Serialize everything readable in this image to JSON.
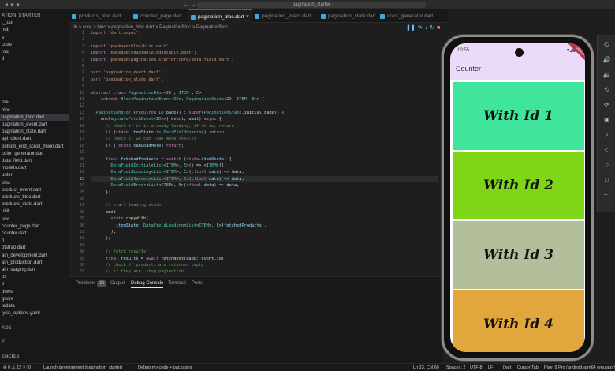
{
  "window": {
    "title": "pagination_starter"
  },
  "tabs": [
    {
      "label": "products_bloc.dart",
      "active": false
    },
    {
      "label": "counter_page.dart",
      "active": false
    },
    {
      "label": "pagination_bloc.dart",
      "active": true
    },
    {
      "label": "pagination_event.dart",
      "active": false
    },
    {
      "label": "pagination_state.dart",
      "active": false
    },
    {
      "label": "color_generator.dart",
      "active": false
    }
  ],
  "breadcrumb": "lib > core > bloc > pagination_bloc.dart > PaginationBloc > PaginationBloc",
  "sidebar": {
    "items": [
      {
        "label": "ATION_STARTER",
        "kind": "section"
      },
      {
        "label": "t_tool"
      },
      {
        "label": "hub"
      },
      {
        "label": "e"
      },
      {
        "label": "code"
      },
      {
        "label": "roid"
      },
      {
        "label": "d"
      },
      {
        "label": ""
      },
      {
        "label": ""
      },
      {
        "label": ""
      },
      {
        "label": ""
      },
      {
        "label": ""
      },
      {
        "label": "ore"
      },
      {
        "label": "bloc"
      },
      {
        "label": "pagination_bloc.dart",
        "active": true
      },
      {
        "label": "pagination_event.dart"
      },
      {
        "label": "pagination_state.dart"
      },
      {
        "label": "api_client.dart"
      },
      {
        "label": "bottom_end_scroll_mixin.dart"
      },
      {
        "label": "color_generator.dart"
      },
      {
        "label": "data_field.dart"
      },
      {
        "label": "models.dart"
      },
      {
        "label": "unter"
      },
      {
        "label": "bloc"
      },
      {
        "label": "product_event.dart"
      },
      {
        "label": "products_bloc.dart"
      },
      {
        "label": "products_state.dart"
      },
      {
        "label": "ubit"
      },
      {
        "label": "iew"
      },
      {
        "label": "counter_page.dart"
      },
      {
        "label": "counter.dart"
      },
      {
        "label": "n"
      },
      {
        "label": "otstrap.dart"
      },
      {
        "label": "ain_development.dart"
      },
      {
        "label": "ain_production.dart"
      },
      {
        "label": "ain_staging.dart"
      },
      {
        "label": "os"
      },
      {
        "label": "b"
      },
      {
        "label": "dows"
      },
      {
        "label": "gnore"
      },
      {
        "label": "tadata"
      },
      {
        "label": "lysis_options.yaml"
      },
      {
        "label": ""
      },
      {
        "label": "ADS",
        "kind": "section"
      },
      {
        "label": ""
      },
      {
        "label": "E",
        "kind": "section"
      },
      {
        "label": ""
      },
      {
        "label": "ENCIES",
        "kind": "section"
      }
    ]
  },
  "code": {
    "current_line": 23,
    "first_line": 1,
    "lines": [
      [
        [
          "kw",
          "import "
        ],
        [
          "st",
          "'dart:async'"
        ],
        [
          "",
          "; "
        ]
      ],
      [],
      [
        [
          "kw",
          "import "
        ],
        [
          "st",
          "'package:bloc/bloc.dart'"
        ],
        [
          "",
          ";"
        ]
      ],
      [
        [
          "kw",
          "import "
        ],
        [
          "st",
          "'package:equatable/equatable.dart'"
        ],
        [
          "",
          ";"
        ]
      ],
      [
        [
          "kw",
          "import "
        ],
        [
          "st",
          "'package:pagination_starter/core/data_field.dart'"
        ],
        [
          "",
          ";"
        ]
      ],
      [],
      [
        [
          "kw",
          "part "
        ],
        [
          "st",
          "'pagination_event.dart'"
        ],
        [
          "",
          ";"
        ]
      ],
      [
        [
          "kw",
          "part "
        ],
        [
          "st",
          "'pagination_state.dart'"
        ],
        [
          "",
          ";"
        ]
      ],
      [],
      [
        [
          "kw",
          "abstract class "
        ],
        [
          "ty",
          "PaginationBloc"
        ],
        [
          "",
          "<"
        ],
        [
          "ty",
          "ID"
        ],
        [
          "",
          " , "
        ],
        [
          "ty",
          "ITEM"
        ],
        [
          "",
          " , "
        ],
        [
          "ty",
          "E"
        ],
        [
          "",
          ">"
        ]
      ],
      [
        [
          "",
          "    "
        ],
        [
          "kw",
          "extends "
        ],
        [
          "ty",
          "Bloc"
        ],
        [
          "",
          "<"
        ],
        [
          "ty",
          "PaginationEvent"
        ],
        [
          "",
          "<"
        ],
        [
          "ty",
          "ID"
        ],
        [
          "",
          ">, "
        ],
        [
          "ty",
          "PaginationState"
        ],
        [
          "",
          "<"
        ],
        [
          "ty",
          "ID"
        ],
        [
          "",
          ", "
        ],
        [
          "ty",
          "ITEM"
        ],
        [
          "",
          ", "
        ],
        [
          "ty",
          "E"
        ],
        [
          "",
          ">> {"
        ]
      ],
      [],
      [
        [
          "",
          "  "
        ],
        [
          "ty",
          "PaginationBloc"
        ],
        [
          "",
          "({"
        ],
        [
          "kw",
          "required "
        ],
        [
          "ty",
          "ID "
        ],
        [
          "va",
          "page"
        ],
        [
          "",
          "}) : "
        ],
        [
          "kw",
          "super"
        ],
        [
          "",
          "("
        ],
        [
          "ty",
          "PaginationState"
        ],
        [
          "",
          "."
        ],
        [
          "fn",
          "initial"
        ],
        [
          "",
          "("
        ],
        [
          "va",
          "page"
        ],
        [
          "",
          ")) {"
        ]
      ],
      [
        [
          "",
          "    "
        ],
        [
          "fn",
          "on"
        ],
        [
          "",
          "<"
        ],
        [
          "ty",
          "PaginateFetchEvent"
        ],
        [
          "",
          "<"
        ],
        [
          "ty",
          "ID"
        ],
        [
          "",
          ">>((event, emit) "
        ],
        [
          "kw",
          "async "
        ],
        [
          "",
          "{"
        ]
      ],
      [
        [
          "",
          "      "
        ],
        [
          "cm",
          "// check if it is already loading, if it is, return"
        ]
      ],
      [
        [
          "",
          "      "
        ],
        [
          "kw",
          "if "
        ],
        [
          "",
          "("
        ],
        [
          "kw",
          "state"
        ],
        [
          "",
          "."
        ],
        [
          "va",
          "itemState "
        ],
        [
          "kw",
          "is "
        ],
        [
          "ty",
          "DataFieldLoading"
        ],
        [
          "",
          ") "
        ],
        [
          "kw",
          "return"
        ],
        [
          "",
          ";"
        ]
      ],
      [
        [
          "",
          "      "
        ],
        [
          "cm",
          "// check if we can load more results"
        ]
      ],
      [
        [
          "",
          "      "
        ],
        [
          "kw",
          "if "
        ],
        [
          "",
          "(!"
        ],
        [
          "kw",
          "state"
        ],
        [
          "",
          "."
        ],
        [
          "va",
          "canLoadMore"
        ],
        [
          "",
          ") "
        ],
        [
          "kw",
          "return"
        ],
        [
          "",
          ";"
        ]
      ],
      [],
      [
        [
          "",
          "      "
        ],
        [
          "kw",
          "final "
        ],
        [
          "va",
          "fetchedProducts "
        ],
        [
          "",
          "= "
        ],
        [
          "kw",
          "switch "
        ],
        [
          "",
          "("
        ],
        [
          "kw",
          "state"
        ],
        [
          "",
          "."
        ],
        [
          "va",
          "itemState"
        ],
        [
          "",
          ") {"
        ]
      ],
      [
        [
          "",
          "        "
        ],
        [
          "ty",
          "DataFieldInitial"
        ],
        [
          "",
          "<"
        ],
        [
          "ty",
          "List"
        ],
        [
          "",
          "<"
        ],
        [
          "ty",
          "ITEM"
        ],
        [
          "",
          ">, "
        ],
        [
          "ty",
          "E"
        ],
        [
          "",
          ">() => <"
        ],
        [
          "ty",
          "ITEM"
        ],
        [
          "",
          ">[],"
        ]
      ],
      [
        [
          "",
          "        "
        ],
        [
          "ty",
          "DataFieldLoading"
        ],
        [
          "",
          "<"
        ],
        [
          "ty",
          "List"
        ],
        [
          "",
          "<"
        ],
        [
          "ty",
          "ITEM"
        ],
        [
          "",
          ">, "
        ],
        [
          "ty",
          "E"
        ],
        [
          "",
          ">(:"
        ],
        [
          "kw",
          "final "
        ],
        [
          "va",
          "data"
        ],
        [
          "",
          ") => "
        ],
        [
          "va",
          "data"
        ],
        [
          "",
          ","
        ]
      ],
      [
        [
          "",
          "        "
        ],
        [
          "ty",
          "DataFieldSuccess"
        ],
        [
          "",
          "<"
        ],
        [
          "ty",
          "List"
        ],
        [
          "",
          "<"
        ],
        [
          "ty",
          "ITEM"
        ],
        [
          "",
          ">, "
        ],
        [
          "ty",
          "E"
        ],
        [
          "",
          ">(:"
        ],
        [
          "kw",
          "final "
        ],
        [
          "va",
          "data"
        ],
        [
          "",
          ") => "
        ],
        [
          "va",
          "data"
        ],
        [
          "",
          ","
        ]
      ],
      [
        [
          "",
          "        "
        ],
        [
          "ty",
          "DataFieldError"
        ],
        [
          "",
          "<"
        ],
        [
          "ty",
          "List"
        ],
        [
          "",
          "<"
        ],
        [
          "ty",
          "ITEM"
        ],
        [
          "",
          ">, "
        ],
        [
          "ty",
          "E"
        ],
        [
          "",
          ">(:"
        ],
        [
          "kw",
          "final "
        ],
        [
          "va",
          "data"
        ],
        [
          "",
          ") => "
        ],
        [
          "va",
          "data"
        ],
        [
          "",
          ","
        ]
      ],
      [
        [
          "",
          "      };"
        ]
      ],
      [],
      [
        [
          "",
          "      "
        ],
        [
          "cm",
          "// start loading state"
        ]
      ],
      [
        [
          "",
          "      "
        ],
        [
          "fn",
          "emit"
        ],
        [
          "",
          "("
        ]
      ],
      [
        [
          "",
          "        "
        ],
        [
          "kw",
          "state"
        ],
        [
          "",
          "."
        ],
        [
          "fn",
          "copyWith"
        ],
        [
          "",
          "("
        ]
      ],
      [
        [
          "",
          "          "
        ],
        [
          "va",
          "itemState"
        ],
        [
          "",
          ": "
        ],
        [
          "ty",
          "DataFieldLoading"
        ],
        [
          "",
          "<"
        ],
        [
          "ty",
          "List"
        ],
        [
          "",
          "<"
        ],
        [
          "ty",
          "ITEM"
        ],
        [
          "",
          ">, "
        ],
        [
          "ty",
          "E"
        ],
        [
          "",
          ">("
        ],
        [
          "va",
          "fetchedProducts"
        ],
        [
          "",
          "),"
        ]
      ],
      [
        [
          "",
          "        ),"
        ]
      ],
      [
        [
          "",
          "      );"
        ]
      ],
      [],
      [
        [
          "",
          "      "
        ],
        [
          "cm",
          "// fetch results"
        ]
      ],
      [
        [
          "",
          "      "
        ],
        [
          "kw",
          "final "
        ],
        [
          "va",
          "results "
        ],
        [
          "",
          "= "
        ],
        [
          "kw",
          "await "
        ],
        [
          "fn",
          "fetchNext"
        ],
        [
          "",
          "("
        ],
        [
          "va",
          "page"
        ],
        [
          "",
          ": event."
        ],
        [
          "va",
          "id"
        ],
        [
          "",
          ");"
        ]
      ],
      [
        [
          "",
          "      "
        ],
        [
          "cm",
          "// check if products are returned empty"
        ]
      ],
      [
        [
          "",
          "      "
        ],
        [
          "cm",
          "// if they are, stop pagination"
        ]
      ],
      [
        [
          "",
          "      "
        ],
        [
          "kw",
          "if "
        ],
        [
          "",
          "("
        ],
        [
          "va",
          "results"
        ],
        [
          "",
          "."
        ],
        [
          "va",
          "$1"
        ],
        [
          "",
          "."
        ],
        [
          "va",
          "isEmpty"
        ],
        [
          "",
          ") {"
        ]
      ],
      [
        [
          "",
          "        "
        ],
        [
          "fn",
          "emit"
        ],
        [
          "",
          "("
        ]
      ],
      [
        [
          "",
          "          "
        ],
        [
          "kw",
          "state"
        ],
        [
          "",
          "."
        ],
        [
          "fn",
          "copyWith"
        ],
        [
          "",
          "("
        ]
      ]
    ]
  },
  "panel": {
    "tabs": [
      {
        "label": "Problems",
        "badge": "10"
      },
      {
        "label": "Output"
      },
      {
        "label": "Debug Console",
        "active": true
      },
      {
        "label": "Terminal"
      },
      {
        "label": "Ports"
      }
    ]
  },
  "statusbar": {
    "errors": "0",
    "warnings": "12",
    "info": "0",
    "launch": "Launch development (pagination_starter)",
    "debug": "Debug my code + packages",
    "position": "Ln 23, Col 60",
    "spaces": "Spaces: 2",
    "encoding": "UTF-8",
    "eol": "LF",
    "language": "Dart",
    "cursor": "Cursor Tab",
    "device": "Pixel 9 Pro (android-arm64 emulator)"
  },
  "emulator": {
    "time": "10:55",
    "app_title": "Counter",
    "cards": [
      {
        "label": "With Id 1",
        "color": "#3fe59a"
      },
      {
        "label": "With Id 2",
        "color": "#7fd616"
      },
      {
        "label": "With Id 3",
        "color": "#b3be9b"
      },
      {
        "label": "With Id 4",
        "color": "#e1a73c"
      }
    ],
    "side_controls": [
      "power-icon",
      "volume-up-icon",
      "volume-down-icon",
      "rotate-left-icon",
      "rotate-right-icon",
      "camera-icon",
      "zoom-icon",
      "back-icon",
      "home-icon",
      "overview-icon",
      "more-icon"
    ]
  },
  "colors": {
    "accent": "#0078d4",
    "appbar": "#eadcf8",
    "debug_banner": "#b7384b"
  }
}
